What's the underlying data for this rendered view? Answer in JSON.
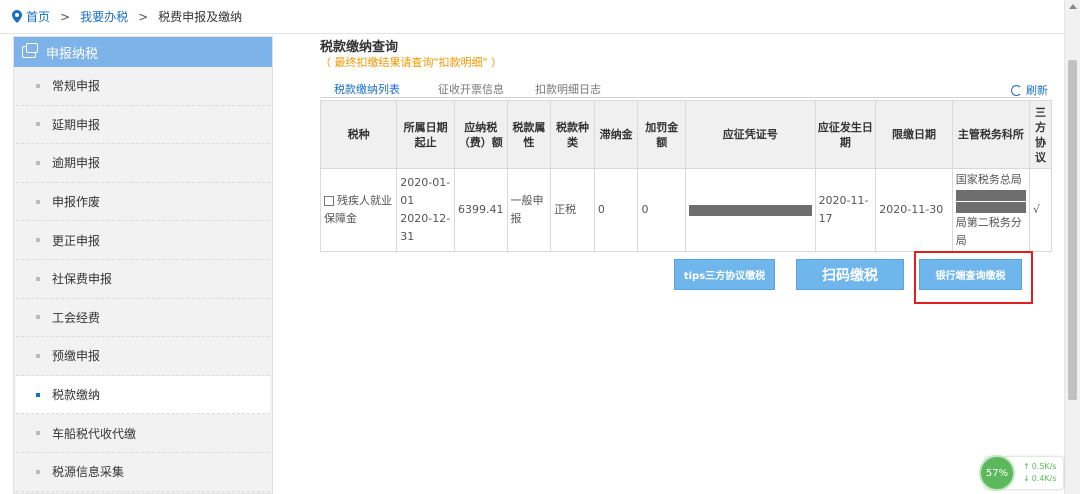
{
  "breadcrumb": {
    "home": "首页",
    "sep1": ">",
    "level1": "我要办税",
    "sep2": ">",
    "current": "税费申报及缴纳"
  },
  "sidebar": {
    "header": "申报纳税",
    "items": [
      {
        "label": "常规申报"
      },
      {
        "label": "延期申报"
      },
      {
        "label": "逾期申报"
      },
      {
        "label": "申报作废"
      },
      {
        "label": "更正申报"
      },
      {
        "label": "社保费申报"
      },
      {
        "label": "工会经费"
      },
      {
        "label": "预缴申报"
      },
      {
        "label": "税款缴纳",
        "active": true
      },
      {
        "label": "车船税代收代缴"
      },
      {
        "label": "税源信息采集"
      }
    ]
  },
  "main": {
    "title": "税款缴纳查询",
    "notice": "（ 最终扣缴结果请查询\"扣款明细\" ）",
    "tabs": [
      "税款缴纳列表",
      "征收开票信息",
      "扣款明细日志"
    ],
    "refresh": "刷新",
    "table": {
      "headers": [
        "税种",
        "所属日期起止",
        "应纳税（费）额",
        "税款属性",
        "税款种类",
        "滞纳金",
        "加罚金额",
        "应征凭证号",
        "应征发生日期",
        "限缴日期",
        "主管税务科所",
        "三方协议"
      ],
      "rows": [
        {
          "tax_type": "残疾人就业保障金",
          "period_start": "2020-01-01",
          "period_end": "2020-12-31",
          "amount": "6399.41",
          "attribute": "一般申报",
          "category": "正税",
          "late_fee": "0",
          "penalty": "0",
          "voucher_no": "",
          "occur_date": "2020-11-17",
          "deadline": "2020-11-30",
          "office_line1": "国家税务总局",
          "office_line2": "局第二税务分局",
          "agreement": "√"
        }
      ]
    },
    "buttons": {
      "tips": "tips三方协议缴税",
      "scan": "扫码缴税",
      "bank": "银行端查询缴税"
    }
  },
  "widget": {
    "percent": "57%",
    "up": "0.5K/s",
    "down": "0.4K/s"
  },
  "colors": {
    "accent": "#1a6fc4",
    "sidebar_header": "#7eb3e9",
    "button": "#6fb6ec",
    "highlight": "#e02020",
    "notice": "#f39800"
  }
}
